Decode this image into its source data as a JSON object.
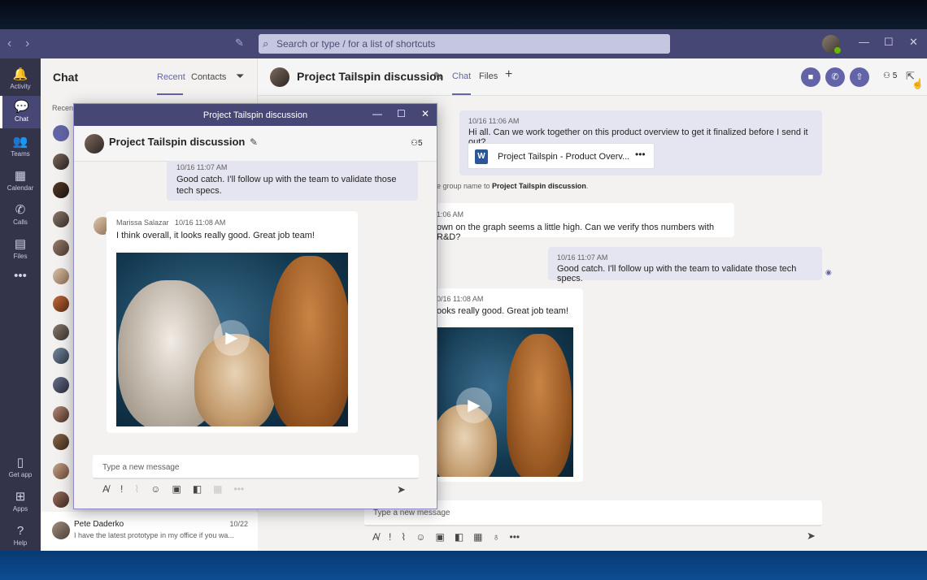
{
  "search": {
    "placeholder": "Search or type / for a list of shortcuts"
  },
  "rail": [
    {
      "label": "Activity",
      "glyph": "🔔"
    },
    {
      "label": "Chat",
      "glyph": "💬"
    },
    {
      "label": "Teams",
      "glyph": "👥"
    },
    {
      "label": "Calendar",
      "glyph": "▦"
    },
    {
      "label": "Calls",
      "glyph": "✆"
    },
    {
      "label": "Files",
      "glyph": "▤"
    },
    {
      "label": "",
      "glyph": "•••"
    },
    {
      "label": "Get app",
      "glyph": "▯"
    },
    {
      "label": "Apps",
      "glyph": "⊞"
    },
    {
      "label": "Help",
      "glyph": "?"
    }
  ],
  "chatlist": {
    "title": "Chat",
    "tab_recent": "Recent",
    "tab_contacts": "Contacts",
    "recent_label": "Recen",
    "pete": {
      "name": "Pete Daderko",
      "date": "10/22",
      "preview": "I have the latest prototype in my office if you wa..."
    }
  },
  "main": {
    "title": "Project Tailspin discussion",
    "tab_chat": "Chat",
    "tab_files": "Files",
    "participants": "5",
    "msg1": {
      "meta": "10/16 11:06 AM",
      "text": "Hi all.  Can we work together on this product overview to get it finalized before I send it out?"
    },
    "file": {
      "name": "Project Tailspin - Product Overv...",
      "dots": "•••"
    },
    "sys_rename": {
      "prefix": "e group name to ",
      "name": "Project Tailspin discussion",
      "suffix": "."
    },
    "msg2": {
      "meta": "1:06 AM",
      "text": "own on the graph seems a little high.  Can we verify thos numbers with R&D?"
    },
    "msg3": {
      "meta": "10/16 11:07 AM",
      "text": "Good catch.  I'll follow up with the team to validate those tech specs."
    },
    "msg4": {
      "meta": "0/16 11:08 AM",
      "text": "ooks really good.  Great job team!"
    },
    "composer_placeholder": "Type a new message"
  },
  "popout": {
    "window_title": "Project Tailspin discussion",
    "title": "Project Tailspin discussion",
    "participants": "5",
    "msg1": {
      "meta": "10/16 11:07 AM",
      "text": "Good catch.  I'll follow up with the team to validate those tech specs."
    },
    "msg2": {
      "author": "Marissa Salazar",
      "time": "10/16 11:08 AM",
      "text": "I think overall, it looks really good.  Great job team!"
    },
    "composer_placeholder": "Type a new message"
  }
}
